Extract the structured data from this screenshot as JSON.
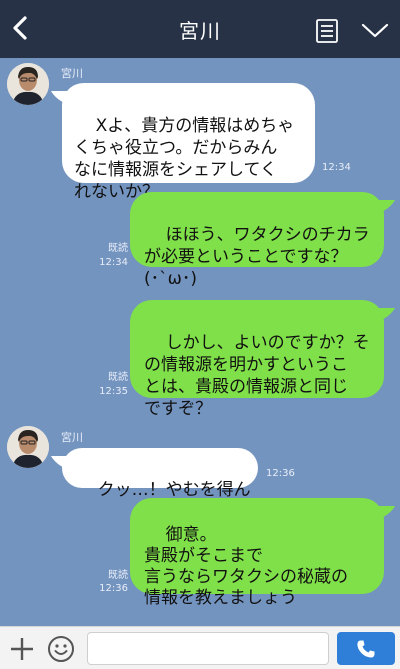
{
  "header": {
    "title": "宮川"
  },
  "messages": [
    {
      "side": "in",
      "sender": "宮川",
      "text": "Xよ、貴方の情報はめちゃ\nくちゃ役立つ。だからみん\nなに情報源をシェアしてく\nれないか？",
      "time": "12:34"
    },
    {
      "side": "out",
      "text": "ほほう、ワタクシのチカラ\nが必要ということですな？\n(･`ω･)",
      "read": "既読",
      "time": "12:34"
    },
    {
      "side": "out",
      "text": "しかし、よいのですか？そ\nの情報源を明かすというこ\nとは、貴殿の情報源と同じ\nですぞ？",
      "read": "既読",
      "time": "12:35"
    },
    {
      "side": "in",
      "sender": "宮川",
      "text": "クッ…！やむを得ん",
      "time": "12:36"
    },
    {
      "side": "out",
      "text": "御意。\n貴殿がそこまで\n言うならワタクシの秘蔵の\n情報を教えましょう",
      "read": "既読",
      "time": "12:36"
    }
  ],
  "input": {
    "value": "",
    "placeholder": ""
  },
  "colors": {
    "header": "#273246",
    "background": "#7494c0",
    "outgoing": "#80e049",
    "incoming": "#ffffff",
    "send": "#2f7fd8"
  },
  "icons": {
    "back": "chevron-left-icon",
    "menu": "note-list-icon",
    "more": "chevron-down-icon",
    "plus": "plus-icon",
    "emoji": "smiley-icon",
    "send": "phone-icon"
  }
}
